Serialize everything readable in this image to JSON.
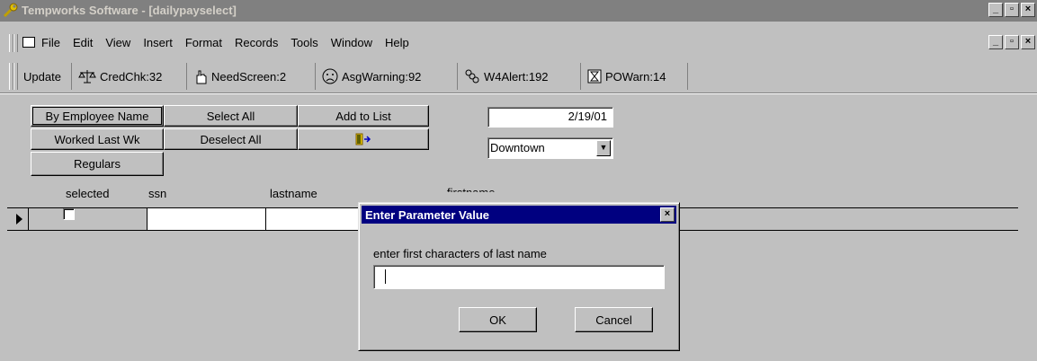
{
  "window": {
    "title": "Tempworks Software - [dailypayselect]"
  },
  "menu": {
    "items": [
      "File",
      "Edit",
      "View",
      "Insert",
      "Format",
      "Records",
      "Tools",
      "Window",
      "Help"
    ]
  },
  "toolbar": {
    "update": "Update",
    "credchk": "CredChk:32",
    "needscreen": "NeedScreen:2",
    "asgwarning": "AsgWarning:92",
    "w4alert": "W4Alert:192",
    "powarn": "POWarn:14"
  },
  "form": {
    "by_employee_name": "By Employee Name",
    "worked_last_wk": "Worked Last Wk",
    "regulars": "Regulars",
    "select_all": "Select All",
    "deselect_all": "Deselect All",
    "add_to_list": "Add to List",
    "date": "2/19/01",
    "location": "Downtown"
  },
  "grid": {
    "headers": {
      "selected": "selected",
      "ssn": "ssn",
      "lastname": "lastname",
      "firstname": "firstname"
    }
  },
  "dialog": {
    "title": "Enter Parameter Value",
    "prompt": "enter first characters of last name",
    "value": "",
    "ok": "OK",
    "cancel": "Cancel"
  },
  "colors": {
    "dialog_title": "#000080",
    "inactive_title": "#808080",
    "face": "#c0c0c0"
  }
}
